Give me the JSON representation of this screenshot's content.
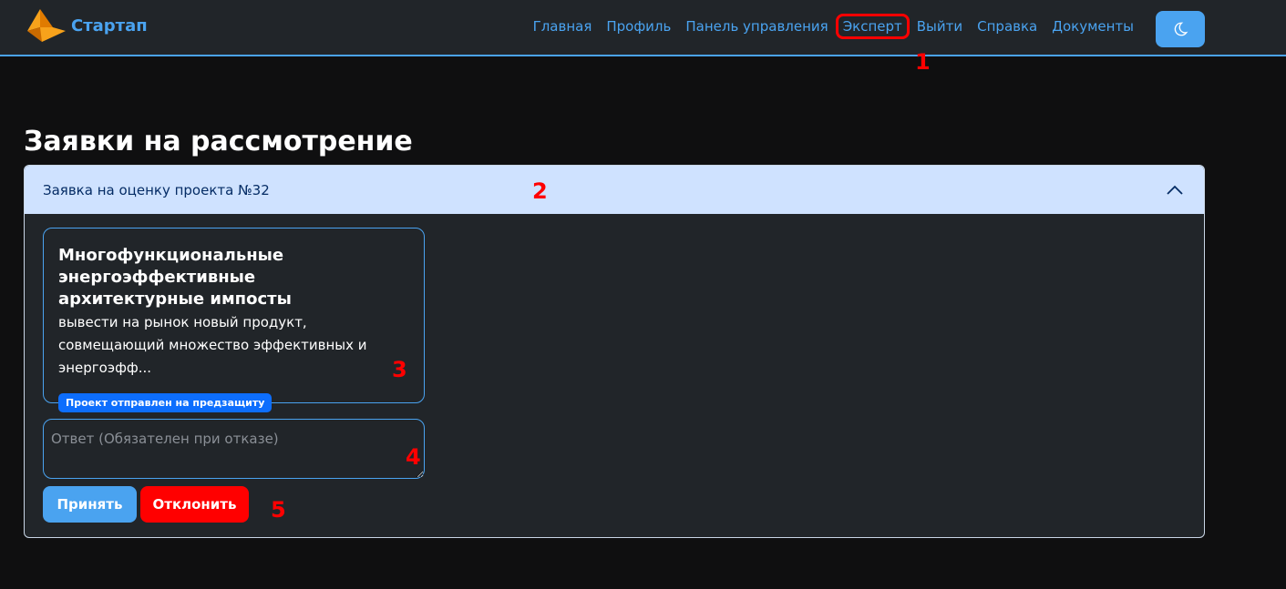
{
  "brand": {
    "name": "Стартап",
    "logo_icon": "pyramid-logo-icon"
  },
  "nav": {
    "items": [
      {
        "label": "Главная"
      },
      {
        "label": "Профиль"
      },
      {
        "label": "Панель управления"
      },
      {
        "label": "Эксперт"
      },
      {
        "label": "Выйти"
      },
      {
        "label": "Справка"
      },
      {
        "label": "Документы"
      }
    ],
    "theme_icon": "moon-icon"
  },
  "annotations": [
    "1",
    "2",
    "3",
    "4",
    "5"
  ],
  "page": {
    "title": "Заявки на рассмотрение"
  },
  "request": {
    "header": "Заявка на оценку проекта №32",
    "card": {
      "title": "Многофункциональные энергоэффективные архитектурные импосты",
      "description": "вывести на рынок новый продукт, совмещающий множество эффективных и энергоэфф...",
      "status": "Проект отправлен на предзащиту"
    },
    "answer_placeholder": "Ответ (Обязателен при отказе)",
    "accept_label": "Принять",
    "reject_label": "Отклонить"
  },
  "colors": {
    "accent": "#4aa3f0",
    "danger": "#ff0000",
    "badge": "#0d6efd",
    "header_bg": "#cfe2ff"
  }
}
